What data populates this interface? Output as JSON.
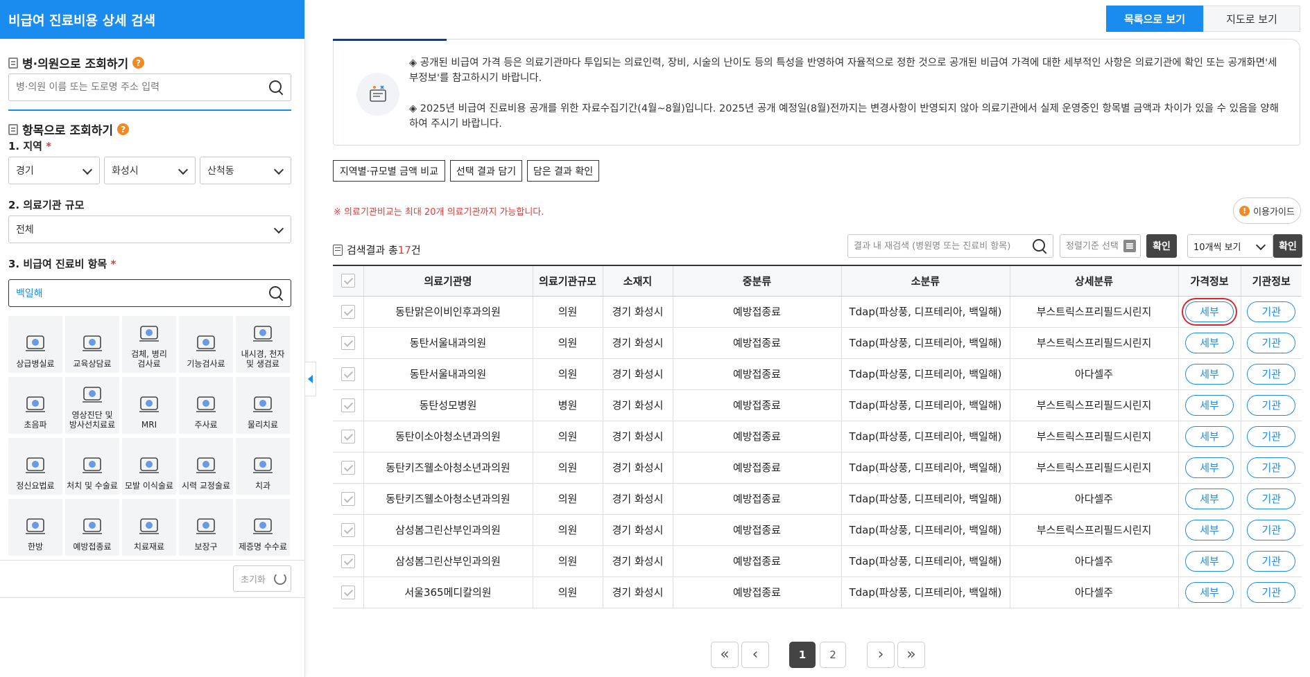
{
  "sidebar": {
    "title": "비급여 진료비용 상세 검색",
    "hospital_search": {
      "title": "병·의원으로 조회하기",
      "help": "?",
      "placeholder": "병·의원 이름 또는 도로명 주소 입력"
    },
    "item_search": {
      "title": "항목으로 조회하기",
      "help": "?",
      "region_label": "1. 지역",
      "region_required": "*",
      "region_values": [
        "경기",
        "화성시",
        "산척동"
      ],
      "scale_label": "2. 의료기관 규모",
      "scale_value": "전체",
      "item_label": "3. 비급여 진료비 항목",
      "item_required": "*",
      "item_value": "백일해"
    },
    "categories": [
      {
        "label": "상급병실료",
        "icon": "hospital-bed-icon"
      },
      {
        "label": "교육상담료",
        "icon": "consultation-icon"
      },
      {
        "label": "검체, 병리\n검사료",
        "icon": "microscope-icon"
      },
      {
        "label": "기능검사료",
        "icon": "function-test-icon"
      },
      {
        "label": "내시경, 천자\n및 생검료",
        "icon": "endoscope-icon"
      },
      {
        "label": "초음파",
        "icon": "ultrasound-icon"
      },
      {
        "label": "영상진단 및\n방사선치료료",
        "icon": "radiation-icon"
      },
      {
        "label": "MRI",
        "icon": "mri-icon"
      },
      {
        "label": "주사료",
        "icon": "syringe-icon"
      },
      {
        "label": "물리치료",
        "icon": "physical-therapy-icon"
      },
      {
        "label": "정신요법료",
        "icon": "brain-icon"
      },
      {
        "label": "처치 및 수술료",
        "icon": "scalpel-icon"
      },
      {
        "label": "모발 이식술료",
        "icon": "hair-icon"
      },
      {
        "label": "시력 교정술료",
        "icon": "eye-icon"
      },
      {
        "label": "치과",
        "icon": "tooth-icon"
      },
      {
        "label": "한방",
        "icon": "acupuncture-icon"
      },
      {
        "label": "예방접종료",
        "icon": "vaccine-icon"
      },
      {
        "label": "치료재료",
        "icon": "material-icon"
      },
      {
        "label": "보장구",
        "icon": "wheelchair-icon"
      },
      {
        "label": "제증명 수수료",
        "icon": "certificate-icon"
      }
    ],
    "reset_label": "초기화"
  },
  "main": {
    "view_list": "목록으로 보기",
    "view_map": "지도로 보기",
    "notice": [
      "◈ 공개된 비급여 가격 등은 의료기관마다 투입되는 의료인력, 장비, 시술의 난이도 등의 특성을 반영하여 자율적으로 정한 것으로 공개된 비급여 가격에 대한 세부적인 사항은 의료기관에 확인 또는 공개화면'세부정보'를 참고하시기 바랍니다.",
      "◈ 2025년 비급여 진료비용 공개를 위한 자료수집기간(4월~8월)입니다. 2025년 공개 예정일(8월)전까지는 변경사항이 반영되지 않아 의료기관에서 실제 운영중인 항목별 금액과 차이가 있을 수 있음을 양해하여 주시기 바랍니다."
    ],
    "actions": [
      "지역별·규모별 금액 비교",
      "선택 결과 담기",
      "담은 결과 확인"
    ],
    "warning": "※ 의료기관비교는 최대 20개 의료기관까지 가능합니다.",
    "guide": "이용가이드",
    "result_prefix": "검색결과 총",
    "result_count": "17",
    "result_suffix": "건",
    "re_search_placeholder": "결과 내 재검색 (병원명 또는 진료비 항목)",
    "sort_placeholder": "정렬기준 선택",
    "confirm": "확인",
    "page_size": "10개씩 보기",
    "columns": [
      "의료기관명",
      "의료기관규모",
      "소재지",
      "중분류",
      "소분류",
      "상세분류",
      "가격정보",
      "기관정보"
    ],
    "detail_label": "세부",
    "org_label": "기관",
    "rows": [
      [
        "동탄맑은이비인후과의원",
        "의원",
        "경기 화성시",
        "예방접종료",
        "Tdap(파상풍, 디프테리아, 백일해)",
        "부스트릭스프리필드시린지"
      ],
      [
        "동탄서울내과의원",
        "의원",
        "경기 화성시",
        "예방접종료",
        "Tdap(파상풍, 디프테리아, 백일해)",
        "부스트릭스프리필드시린지"
      ],
      [
        "동탄서울내과의원",
        "의원",
        "경기 화성시",
        "예방접종료",
        "Tdap(파상풍, 디프테리아, 백일해)",
        "아다셀주"
      ],
      [
        "동탄성모병원",
        "병원",
        "경기 화성시",
        "예방접종료",
        "Tdap(파상풍, 디프테리아, 백일해)",
        "부스트릭스프리필드시린지"
      ],
      [
        "동탄이소아청소년과의원",
        "의원",
        "경기 화성시",
        "예방접종료",
        "Tdap(파상풍, 디프테리아, 백일해)",
        "부스트릭스프리필드시린지"
      ],
      [
        "동탄키즈웰소아청소년과의원",
        "의원",
        "경기 화성시",
        "예방접종료",
        "Tdap(파상풍, 디프테리아, 백일해)",
        "부스트릭스프리필드시린지"
      ],
      [
        "동탄키즈웰소아청소년과의원",
        "의원",
        "경기 화성시",
        "예방접종료",
        "Tdap(파상풍, 디프테리아, 백일해)",
        "아다셀주"
      ],
      [
        "삼성봄그린산부인과의원",
        "의원",
        "경기 화성시",
        "예방접종료",
        "Tdap(파상풍, 디프테리아, 백일해)",
        "부스트릭스프리필드시린지"
      ],
      [
        "삼성봄그린산부인과의원",
        "의원",
        "경기 화성시",
        "예방접종료",
        "Tdap(파상풍, 디프테리아, 백일해)",
        "아다셀주"
      ],
      [
        "서울365메디칼의원",
        "의원",
        "경기 화성시",
        "예방접종료",
        "Tdap(파상풍, 디프테리아, 백일해)",
        "아다셀주"
      ]
    ],
    "pagination": {
      "first": "«",
      "prev": "‹",
      "pages": [
        "1",
        "2"
      ],
      "next": "›",
      "last": "»"
    },
    "accent_color": "#1a8cf0",
    "annotation_color": "#e0242a"
  }
}
